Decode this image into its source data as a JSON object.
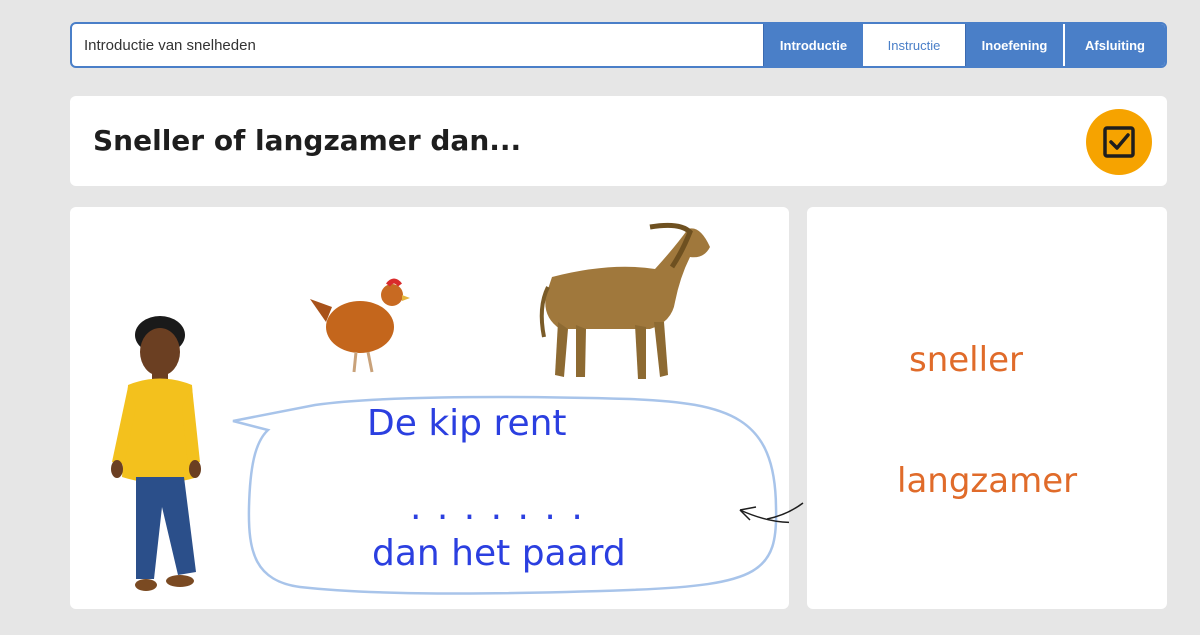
{
  "topbar": {
    "lesson_title": "Introductie van snelheden",
    "tabs": [
      {
        "label": "Introductie"
      },
      {
        "label": "Instructie"
      },
      {
        "label": "Inoefening"
      },
      {
        "label": "Afsluiting"
      }
    ],
    "active_tab": "Instructie"
  },
  "question": {
    "title": "Sneller of langzamer dan...",
    "check_icon": "checkbox-icon",
    "check_color": "#f6a300"
  },
  "scene": {
    "bubble_line1": "De kip rent",
    "bubble_blank": ". . . . . . .",
    "bubble_line2": "dan het paard",
    "images": [
      "boy-figure",
      "chicken-image",
      "horse-image"
    ]
  },
  "answers": {
    "option1": "sneller",
    "option2": "langzamer"
  },
  "colors": {
    "accent": "#4a7fc8",
    "answer_text": "#e06b2a",
    "bubble_text": "#2b3fe0",
    "bubble_outline": "#a8c4ea"
  }
}
